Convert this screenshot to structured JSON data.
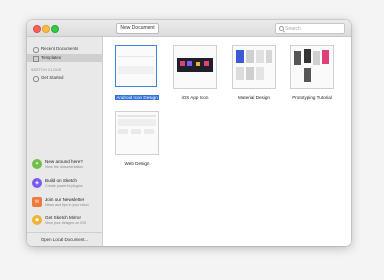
{
  "titlebar": {
    "new_document_label": "New Document",
    "search_placeholder": "Search"
  },
  "sidebar": {
    "items": [
      {
        "label": "Recent Documents",
        "icon": "clock-icon"
      },
      {
        "label": "Templates",
        "icon": "template-icon",
        "selected": true
      }
    ],
    "section_header": "SKETCH CLOUD",
    "cloud_items": [
      {
        "label": "Get Started",
        "icon": "plus-circle-icon"
      }
    ],
    "promos": [
      {
        "title": "New around here?",
        "subtitle": "View the documentation",
        "icon": "compass-icon",
        "color": "#6fbf4a"
      },
      {
        "title": "Build on Sketch",
        "subtitle": "Create powerful plugins",
        "icon": "plugin-icon",
        "color": "#7a5cf0"
      },
      {
        "title": "Join our Newsletter",
        "subtitle": "News and tips in your inbox",
        "icon": "mail-icon",
        "color": "#f07a3a"
      },
      {
        "title": "Get Sketch Mirror",
        "subtitle": "View your designs on iOS",
        "icon": "mirror-icon",
        "color": "#f2b233"
      }
    ],
    "open_local_label": "Open Local Document..."
  },
  "templates": [
    {
      "label": "Android Icon Design",
      "selected": true
    },
    {
      "label": "iOS App Icon"
    },
    {
      "label": "Material Design"
    },
    {
      "label": "Prototyping Tutorial"
    },
    {
      "label": "Web Design"
    }
  ]
}
